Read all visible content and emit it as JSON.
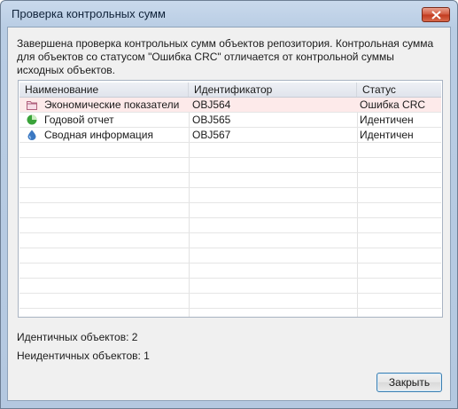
{
  "window": {
    "title": "Проверка контрольных сумм"
  },
  "message": "Завершена проверка контрольных сумм объектов репозитория. Контрольная сумма для объектов со статусом \"Ошибка CRC\" отличается от контрольной суммы исходных объектов.",
  "table": {
    "columns": [
      "Наименование",
      "Идентификатор",
      "Статус"
    ],
    "rows": [
      {
        "name": "Экономические показатели",
        "id": "OBJ564",
        "status": "Ошибка CRC",
        "icon": "folder-icon"
      },
      {
        "name": "Годовой отчет",
        "id": "OBJ565",
        "status": "Идентичен",
        "icon": "pie-chart-icon"
      },
      {
        "name": "Сводная информация",
        "id": "OBJ567",
        "status": "Идентичен",
        "icon": "cube-icon"
      }
    ]
  },
  "summary": {
    "identical": "Идентичных объектов: 2",
    "nonidentical": "Неидентичных объектов: 1"
  },
  "buttons": {
    "close": "Закрыть"
  },
  "colors": {
    "error_row": "#fdeaea",
    "close_button_red": "#c13a1f"
  }
}
